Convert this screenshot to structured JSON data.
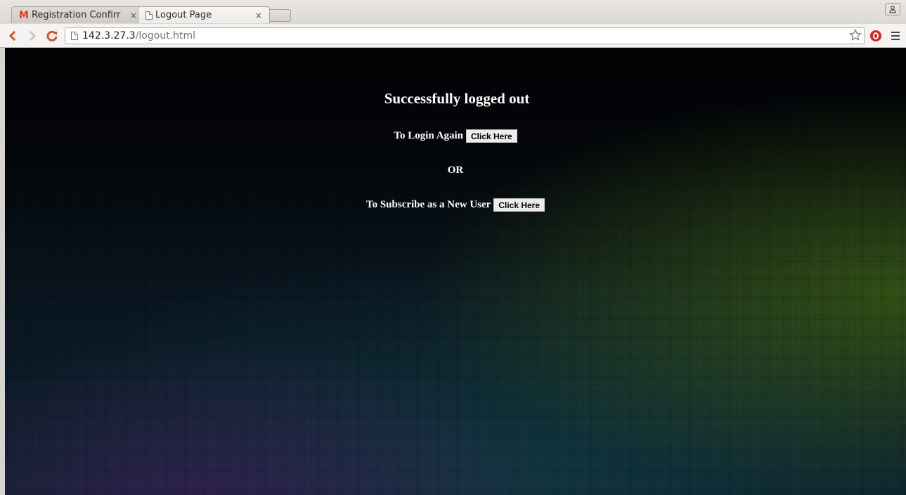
{
  "browser": {
    "tabs": [
      {
        "title": "Registration Confirr",
        "icon": "gmail-icon",
        "close": "×",
        "active": false
      },
      {
        "title": "Logout Page",
        "icon": "page-icon",
        "close": "×",
        "active": true
      }
    ],
    "profile_icon": "person-icon",
    "address": {
      "host": "142.3.27.3",
      "path": "/logout.html"
    },
    "colors": {
      "nav_accent": "#d65420",
      "opera_red": "#d9231d"
    }
  },
  "page": {
    "heading": "Successfully logged out",
    "login": {
      "text": "To Login Again",
      "button": "Click Here"
    },
    "separator": "OR",
    "subscribe": {
      "text": "To Subscribe as a New User",
      "button": "Click Here"
    }
  }
}
